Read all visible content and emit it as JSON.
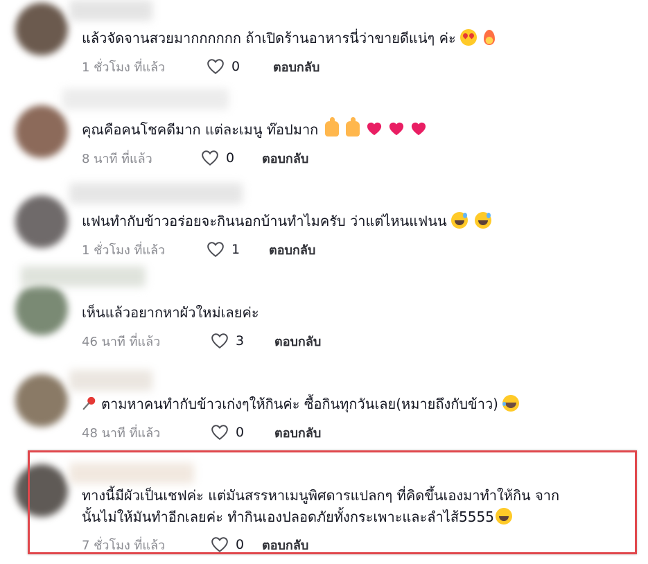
{
  "reply_label": "ตอบกลับ",
  "comments": [
    {
      "text": "แล้วจัดจานสวยมากกกกกก ถ้าเปิดร้านอาหารนี่ว่าขายดีแน่ๆ ค่ะ",
      "time": "1 ชั่วโมง ที่แล้ว",
      "likes": "0",
      "emoji": [
        "smiling-face-with-heart-eyes-icon",
        "fire-icon"
      ]
    },
    {
      "text": "คุณคือคนโชคดีมาก แต่ละเมนู ท๊อปมาก",
      "time": "8 นาที ที่แล้ว",
      "likes": "0",
      "emoji": [
        "thumbs-up-icon",
        "thumbs-up-icon",
        "heart-icon",
        "heart-icon",
        "heart-icon"
      ]
    },
    {
      "text": "แฟนทำกับข้าวอร่อยจะกินนอกบ้านทำไมครับ ว่าแต่ไหนแฟนน",
      "time": "1 ชั่วโมง ที่แล้ว",
      "likes": "1",
      "emoji": [
        "grinning-face-with-sweat-icon",
        "grinning-face-with-sweat-icon"
      ]
    },
    {
      "text": "เห็นแล้วอยากหาผัวใหม่เลยค่ะ",
      "time": "46 นาที ที่แล้ว",
      "likes": "3",
      "emoji": []
    },
    {
      "text": "ตามหาคนทำกับข้าวเก่งๆให้กินค่ะ ซื้อกินทุกวันเลย(หมายถึงกับข้าว)",
      "time": "48 นาที ที่แล้ว",
      "likes": "0",
      "emoji": [
        "pushpin-icon",
        "face-with-tears-of-joy-icon"
      ]
    },
    {
      "text_line1": "ทางนี้มีผัวเป็นเชฟค่ะ แต่มันสรรหาเมนูพิศดารแปลกๆ ที่คิดขึ้นเองมาทำให้กิน จาก",
      "text_line2": "นั้นไม่ให้มันทำอีกเลยค่ะ ทำกินเองปลอดภัยทั้งกระเพาะและลำไส้5555",
      "time": "7 ชั่วโมง ที่แล้ว",
      "likes": "0",
      "emoji": [
        "grinning-squinting-face-icon"
      ]
    }
  ],
  "colors": {
    "highlight_border": "#e0474c",
    "muted_text": "#8a8b91",
    "primary_text": "#161823"
  }
}
